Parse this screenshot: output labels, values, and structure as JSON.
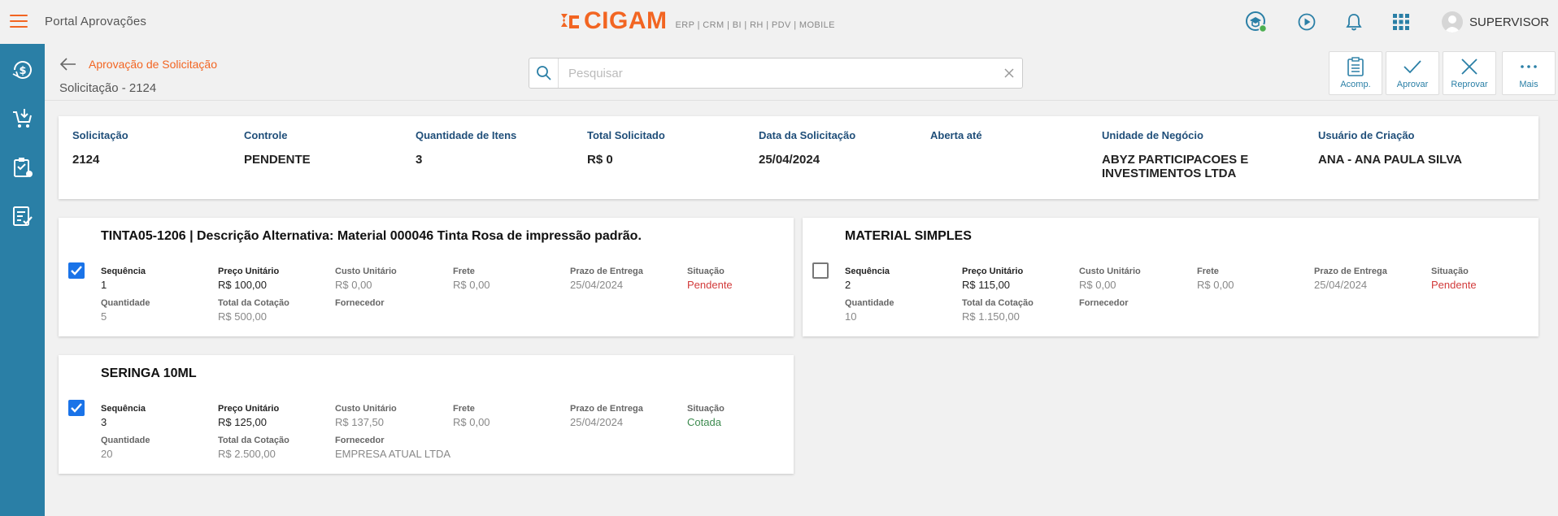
{
  "topbar": {
    "app_title": "Portal Aprovações",
    "logo_text": "CIGAM",
    "logo_sub": "ERP | CRM | BI | RH | PDV | MOBILE",
    "user_name": "SUPERVISOR",
    "colors": {
      "brand": "#f26522",
      "sidebar": "#2a7fa6",
      "online": "#4caf50"
    }
  },
  "sidebar": {
    "items": [
      {
        "icon": "money-cycle-icon"
      },
      {
        "icon": "cart-download-icon"
      },
      {
        "icon": "clipboard-check-icon"
      },
      {
        "icon": "list-check-icon"
      }
    ]
  },
  "header": {
    "breadcrumb": "Aprovação de Solicitação",
    "page_title": "Solicitação - 2124",
    "search_placeholder": "Pesquisar",
    "actions": [
      {
        "label": "Acomp.",
        "icon": "clipboard-list-icon"
      },
      {
        "label": "Aprovar",
        "icon": "check-icon"
      },
      {
        "label": "Reprovar",
        "icon": "close-icon"
      },
      {
        "label": "Mais",
        "icon": "more-icon"
      }
    ]
  },
  "summary": {
    "fields": [
      {
        "label": "Solicitação",
        "value": "2124"
      },
      {
        "label": "Controle",
        "value": "PENDENTE"
      },
      {
        "label": "Quantidade de Itens",
        "value": "3"
      },
      {
        "label": "Total Solicitado",
        "value": "R$ 0"
      },
      {
        "label": "Data da Solicitação",
        "value": "25/04/2024"
      },
      {
        "label": "Aberta até",
        "value": ""
      },
      {
        "label": "Unidade de Negócio",
        "value": "ABYZ PARTICIPACOES E INVESTIMENTOS LTDA"
      },
      {
        "label": "Usuário de Criação",
        "value": "ANA - ANA PAULA SILVA"
      }
    ]
  },
  "labels": {
    "sequencia": "Sequência",
    "preco_unitario": "Preço Unitário",
    "custo_unitario": "Custo Unitário",
    "frete": "Frete",
    "prazo_entrega": "Prazo de Entrega",
    "situacao": "Situação",
    "quantidade": "Quantidade",
    "total_cotacao": "Total da Cotação",
    "fornecedor": "Fornecedor"
  },
  "items": [
    {
      "title": "TINTA05-1206 | Descrição Alternativa: Material 000046 Tinta Rosa de impressão padrão.",
      "checked": true,
      "sequencia": "1",
      "preco_unitario": "R$ 100,00",
      "custo_unitario": "R$ 0,00",
      "frete": "R$ 0,00",
      "prazo_entrega": "25/04/2024",
      "situacao": "Pendente",
      "quantidade": "5",
      "total_cotacao": "R$ 500,00",
      "fornecedor": ""
    },
    {
      "title": "MATERIAL SIMPLES",
      "checked": false,
      "sequencia": "2",
      "preco_unitario": "R$ 115,00",
      "custo_unitario": "R$ 0,00",
      "frete": "R$ 0,00",
      "prazo_entrega": "25/04/2024",
      "situacao": "Pendente",
      "quantidade": "10",
      "total_cotacao": "R$ 1.150,00",
      "fornecedor": ""
    },
    {
      "title": "SERINGA 10ML",
      "checked": true,
      "sequencia": "3",
      "preco_unitario": "R$ 125,00",
      "custo_unitario": "R$ 137,50",
      "frete": "R$ 0,00",
      "prazo_entrega": "25/04/2024",
      "situacao": "Cotada",
      "quantidade": "20",
      "total_cotacao": "R$ 2.500,00",
      "fornecedor": "EMPRESA ATUAL LTDA"
    }
  ]
}
